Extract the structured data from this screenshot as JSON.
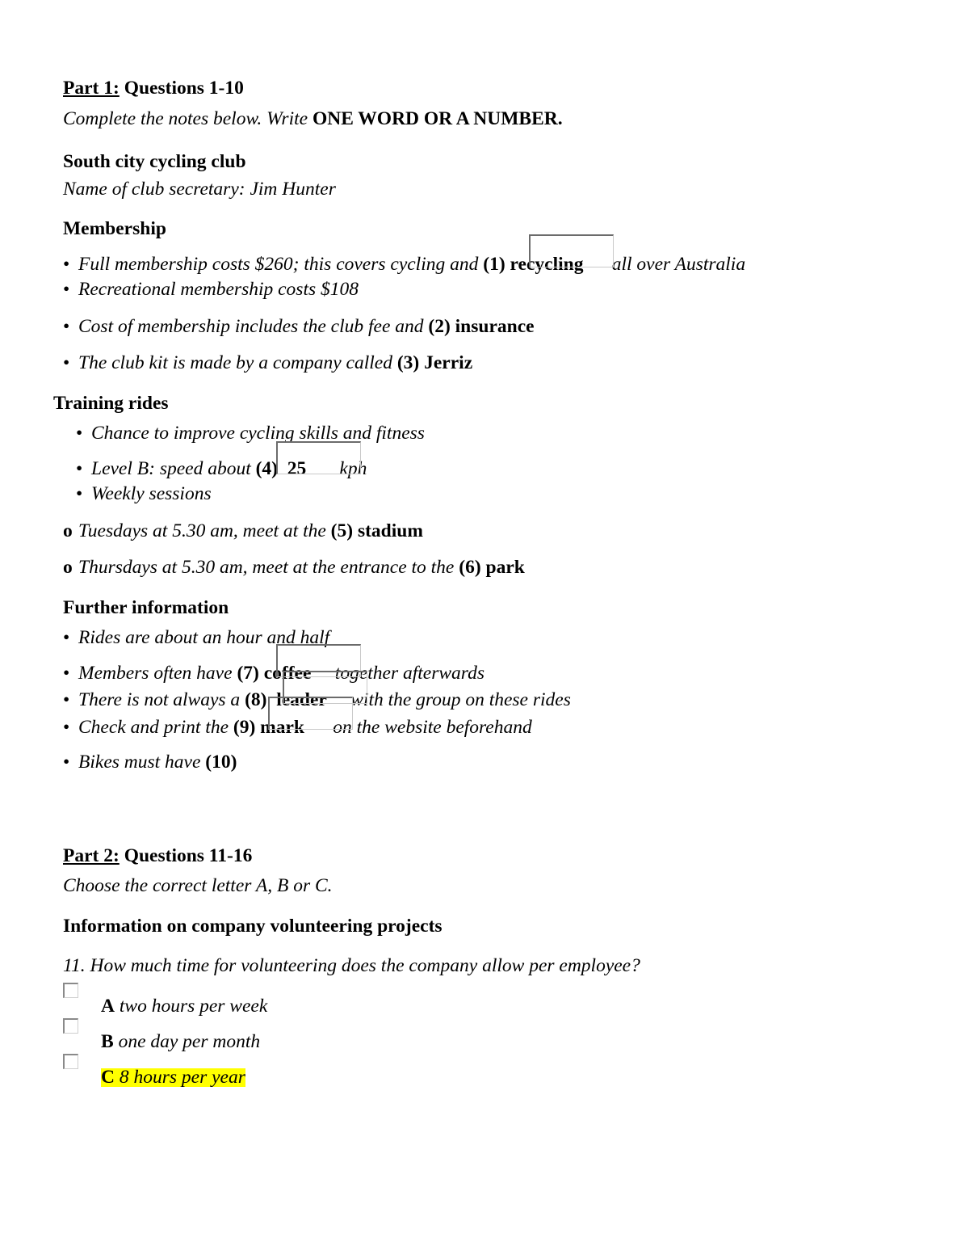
{
  "document": {
    "part1": {
      "label": "Part 1:",
      "questions_range": "Questions 1-10",
      "instruction_italic": "Complete the notes below. Write ",
      "instruction_bold": "ONE WORD OR A NUMBER.",
      "topic_title": "South city cycling club",
      "secretary_line": "Name of club secretary: Jim Hunter",
      "sections": {
        "membership": {
          "heading": "Membership",
          "items": [
            {
              "bullet": "•",
              "pre": "Full membership costs $260; this covers cycling and ",
              "num": "(1)",
              "answer": "recycling",
              "post": " all over Australia",
              "has_box": true
            },
            {
              "bullet": "•",
              "pre": "Recreational membership costs $108",
              "num": "",
              "answer": "",
              "post": "",
              "has_box": false
            },
            {
              "bullet": "•",
              "pre": "Cost of membership includes the club fee and ",
              "num": "(2)",
              "answer": "insurance",
              "post": "",
              "has_box": false
            },
            {
              "bullet": "•",
              "pre": "The club kit is made by a company called ",
              "num": "(3)",
              "answer": "Jerriz",
              "post": "",
              "has_box": false
            }
          ]
        },
        "training": {
          "heading": "Training rides",
          "items": [
            {
              "bullet": "•",
              "pre": "Chance to improve cycling skills and fitness",
              "num": "",
              "answer": "",
              "post": "",
              "has_box": false
            },
            {
              "bullet": "•",
              "pre": "Level B: speed about ",
              "num": "(4)",
              "answer": "25",
              "post": " kph",
              "has_box": true
            },
            {
              "bullet": "•",
              "pre": "Weekly sessions",
              "num": "",
              "answer": "",
              "post": "",
              "has_box": false
            }
          ],
          "sub_items": [
            {
              "bullet": "o",
              "pre": "Tuesdays at 5.30 am, meet at the ",
              "num": "(5)",
              "answer": "stadium",
              "post": ""
            },
            {
              "bullet": "o",
              "pre": "Thursdays at 5.30 am, meet at the entrance to the ",
              "num": "(6)",
              "answer": "park",
              "post": ""
            }
          ]
        },
        "further": {
          "heading": "Further information",
          "items": [
            {
              "bullet": "•",
              "pre": "Rides are about an hour and half",
              "num": "",
              "answer": "",
              "post": "",
              "has_box": false
            },
            {
              "bullet": "•",
              "pre": "Members often have ",
              "num": "(7)",
              "answer": "coffee",
              "post": " together afterwards",
              "has_box": true
            },
            {
              "bullet": "•",
              "pre": "There is not always a ",
              "num": "(8)",
              "answer": "leader",
              "post": " with the group on these rides",
              "has_box": true
            },
            {
              "bullet": "•",
              "pre": "Check and print the ",
              "num": "(9)",
              "answer": "mark",
              "post": " on the website beforehand",
              "has_box": true
            },
            {
              "bullet": "•",
              "pre": "Bikes must have ",
              "num": "(10)",
              "answer": "",
              "post": "",
              "has_box": false
            }
          ]
        }
      }
    },
    "part2": {
      "label": "Part 2:",
      "questions_range": "Questions 11-16",
      "instruction": "Choose the correct letter A, B or C.",
      "topic_title": "Information on company volunteering projects",
      "question_11": {
        "number": "11.",
        "text": " How much time for volunteering does the company allow per employee?",
        "options": [
          {
            "letter": "A",
            "text": " two hours per week",
            "highlighted": false,
            "checked": false
          },
          {
            "letter": "B",
            "text": " one day per month",
            "highlighted": false,
            "checked": false
          },
          {
            "letter": "C",
            "text": " 8 hours per year",
            "highlighted": true,
            "checked": false
          }
        ]
      }
    }
  },
  "colors": {
    "highlight": "#FFFF00",
    "box_border_dark": "#6b6b6b",
    "box_border_light": "#c9c9c9",
    "text": "#000000",
    "page_background": "#ffffff"
  }
}
